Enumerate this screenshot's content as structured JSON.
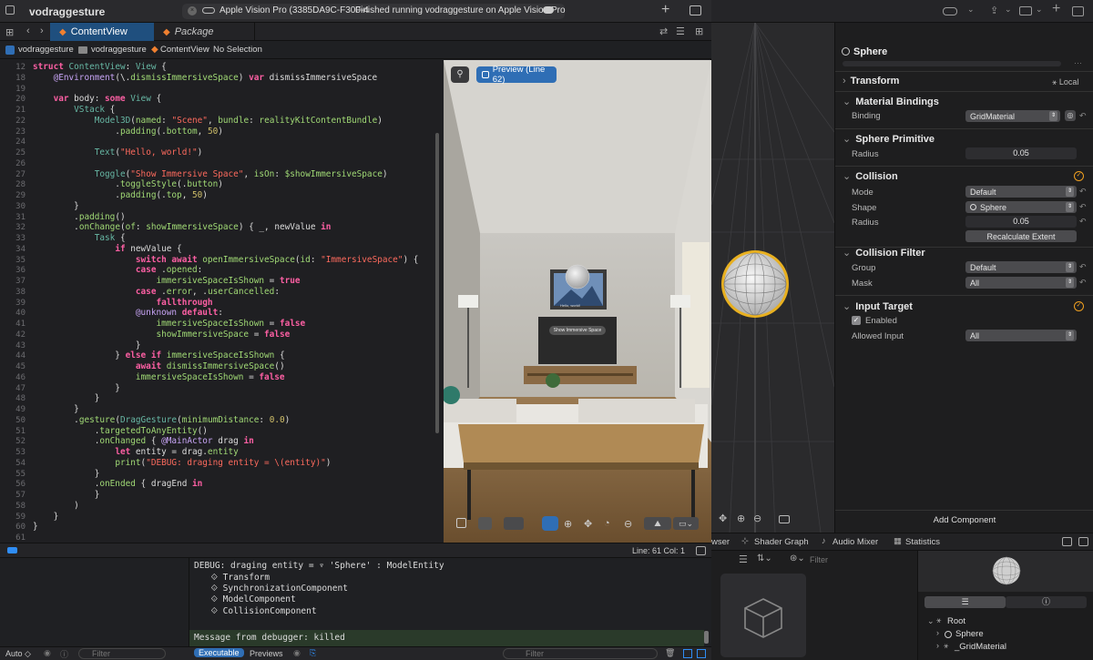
{
  "toolbar": {
    "project": "vodraggesture",
    "destination": "Apple Vision Pro (3385DA9C-F300-4",
    "status": "Finished running vodraggesture on Apple Vision Pro",
    "add_label": "+"
  },
  "tabs": [
    {
      "label": "ContentView",
      "active": true
    },
    {
      "label": "Package",
      "active": false
    }
  ],
  "breadcrumb": {
    "project": "vodraggesture",
    "folder": "vodraggesture",
    "file": "ContentView",
    "selection": "No Selection"
  },
  "code": {
    "line_numbers": [
      "12",
      "18",
      "19",
      "20",
      "21",
      "22",
      "23",
      "24",
      "25",
      "26",
      "27",
      "28",
      "29",
      "30",
      "31",
      "32",
      "33",
      "34",
      "35",
      "36",
      "37",
      "38",
      "39",
      "40",
      "41",
      "42",
      "43",
      "44",
      "45",
      "46",
      "47",
      "48",
      "49",
      "50",
      "51",
      "52",
      "53",
      "54",
      "55",
      "56",
      "57",
      "58",
      "59",
      "60",
      "61"
    ],
    "header": "struct ContentView: View {",
    "line18": "    @Environment(\\.dismissImmersiveSpace) var dismissImmersiveSpace"
  },
  "preview": {
    "label": "Preview (Line 62)",
    "button_text": "Show Immersive Space",
    "mini_text": "Hello, world!"
  },
  "status_bar": {
    "cursor": "Line: 61  Col: 1"
  },
  "debug": {
    "lines": [
      "DEBUG: draging entity = ▿ 'Sphere' : ModelEntity",
      "  ⟐ Transform",
      "  ⟐ SynchronizationComponent",
      "  ⟐ ModelComponent",
      "  ⟐ CollisionComponent"
    ],
    "message": "Message from debugger: killed",
    "auto_label": "Auto ◇",
    "filter_placeholder": "Filter",
    "executable_tab": "Executable",
    "previews_tab": "Previews"
  },
  "inspector": {
    "entity_name": "Sphere",
    "transform": {
      "title": "Transform",
      "local": "Local"
    },
    "material_bindings": {
      "title": "Material Bindings",
      "binding_label": "Binding",
      "binding_value": "GridMaterial"
    },
    "sphere_primitive": {
      "title": "Sphere Primitive",
      "radius_label": "Radius",
      "radius_value": "0.05"
    },
    "collision": {
      "title": "Collision",
      "mode_label": "Mode",
      "mode_value": "Default",
      "shape_label": "Shape",
      "shape_value": "Sphere",
      "radius_label": "Radius",
      "radius_value": "0.05",
      "recalc_label": "Recalculate Extent"
    },
    "collision_filter": {
      "title": "Collision Filter",
      "group_label": "Group",
      "group_value": "Default",
      "mask_label": "Mask",
      "mask_value": "All"
    },
    "input_target": {
      "title": "Input Target",
      "enabled_label": "Enabled",
      "allowed_label": "Allowed Input",
      "allowed_value": "All"
    },
    "add_component": "Add Component"
  },
  "rcp_tabs": {
    "browser": "wser",
    "shader": "Shader Graph",
    "audio": "Audio Mixer",
    "stats": "Statistics"
  },
  "browser": {
    "filter_placeholder": "Filter"
  },
  "hierarchy": {
    "root": "Root",
    "sphere": "Sphere",
    "material": "_GridMaterial"
  },
  "colors": {
    "accent": "#2f6eb5",
    "collision_check": "#f0a020",
    "sphere_highlight": "#e8b020"
  }
}
